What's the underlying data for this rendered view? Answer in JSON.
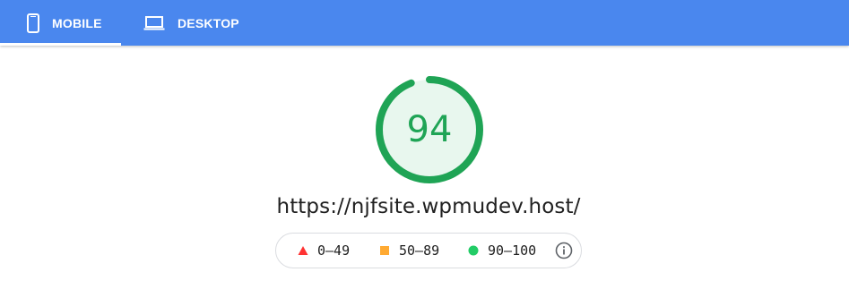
{
  "tabs": [
    {
      "label": "MOBILE",
      "icon": "smartphone-icon",
      "selected": true
    },
    {
      "label": "DESKTOP",
      "icon": "laptop-icon",
      "selected": false
    }
  ],
  "gauge": {
    "score": "94",
    "fraction": 0.94,
    "color": "#1fa455",
    "fill": "#e8f7ee"
  },
  "url": "https://njfsite.wpmudev.host/",
  "legend": {
    "items": [
      {
        "label": "0–49",
        "shape": "triangle",
        "color": "#f33"
      },
      {
        "label": "50–89",
        "shape": "square",
        "color": "#fa3"
      },
      {
        "label": "90–100",
        "shape": "circle",
        "color": "#2c6"
      }
    ],
    "info_icon": "info-icon"
  }
}
